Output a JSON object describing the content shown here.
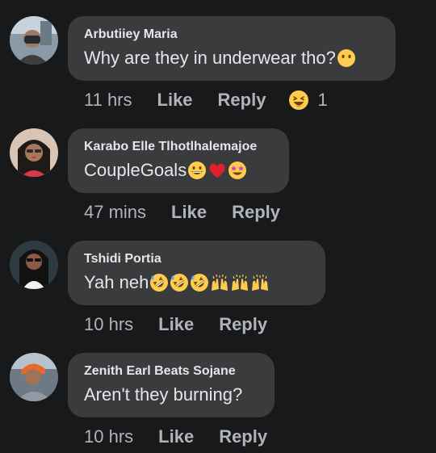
{
  "comments": [
    {
      "author": "Arbutiiey Maria",
      "text": "Why are they in underwear tho?",
      "emojis": [
        "no-mouth-emoji"
      ],
      "time": "11 hrs",
      "like_label": "Like",
      "reply_label": "Reply",
      "reaction": {
        "icon": "laughing-reaction-icon",
        "count": "1"
      }
    },
    {
      "author": "Karabo Elle Tlhotlhalemajoe",
      "text": "CoupleGoals",
      "emojis": [
        "grinning-emoji",
        "red-heart-emoji",
        "star-struck-emoji"
      ],
      "time": "47 mins",
      "like_label": "Like",
      "reply_label": "Reply"
    },
    {
      "author": "Tshidi Portia",
      "text": "Yah neh",
      "emojis": [
        "rofl-emoji",
        "rofl-emoji",
        "rofl-emoji",
        "raising-hands-emoji",
        "raising-hands-emoji",
        "raising-hands-emoji"
      ],
      "time": "10 hrs",
      "like_label": "Like",
      "reply_label": "Reply"
    },
    {
      "author": "Zenith Earl Beats Sojane",
      "text": "Aren't they burning?",
      "emojis": [],
      "time": "10 hrs",
      "like_label": "Like",
      "reply_label": "Reply"
    }
  ],
  "colors": {
    "background": "#18191a",
    "bubble": "#3a3b3c",
    "text": "#e4e6eb",
    "meta": "#b0b3b8",
    "emoji_yellow": "#ffcc4d",
    "heart_red": "#e0202e"
  }
}
